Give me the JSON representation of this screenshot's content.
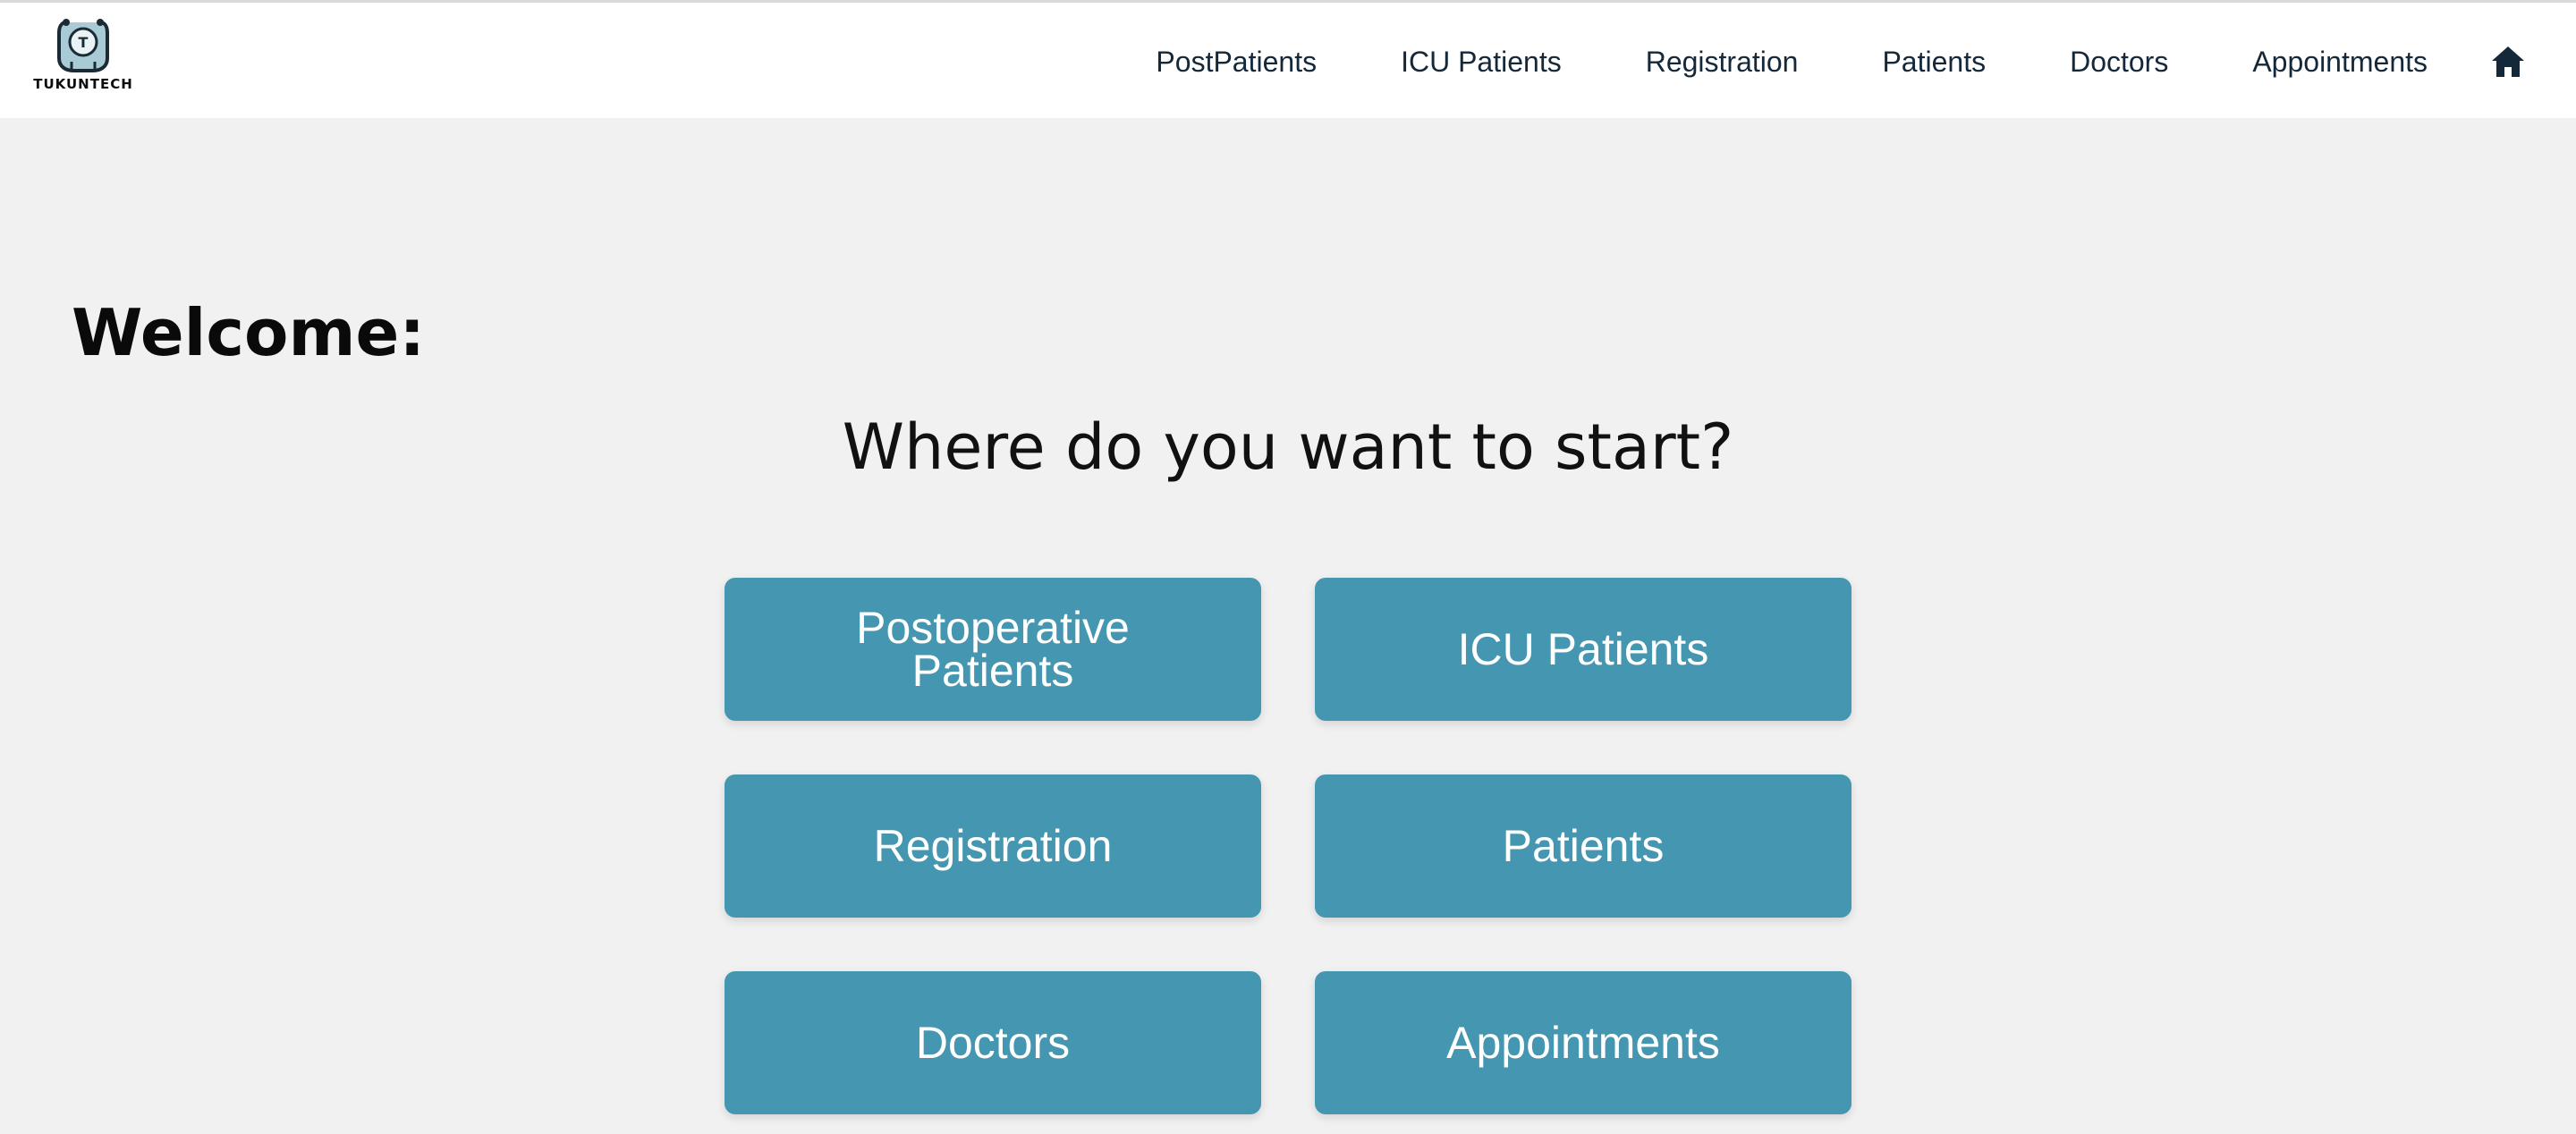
{
  "brand": {
    "name": "TUKUNTECH",
    "logo_icon": "stethoscope-icon",
    "logo_letter": "T"
  },
  "nav": {
    "items": [
      {
        "label": "PostPatients"
      },
      {
        "label": "ICU Patients"
      },
      {
        "label": "Registration"
      },
      {
        "label": "Patients"
      },
      {
        "label": "Doctors"
      },
      {
        "label": "Appointments"
      }
    ],
    "home_icon": "home-icon"
  },
  "main": {
    "welcome": "Welcome:",
    "prompt": "Where do you want to start?",
    "tiles": [
      {
        "label": "Postoperative Patients"
      },
      {
        "label": "ICU Patients"
      },
      {
        "label": "Registration"
      },
      {
        "label": "Patients"
      },
      {
        "label": "Doctors"
      },
      {
        "label": "Appointments"
      }
    ]
  },
  "colors": {
    "tile_background": "#4596b0",
    "page_background": "#f1f1f1",
    "nav_text": "#14283a",
    "header_background": "#ffffff"
  }
}
